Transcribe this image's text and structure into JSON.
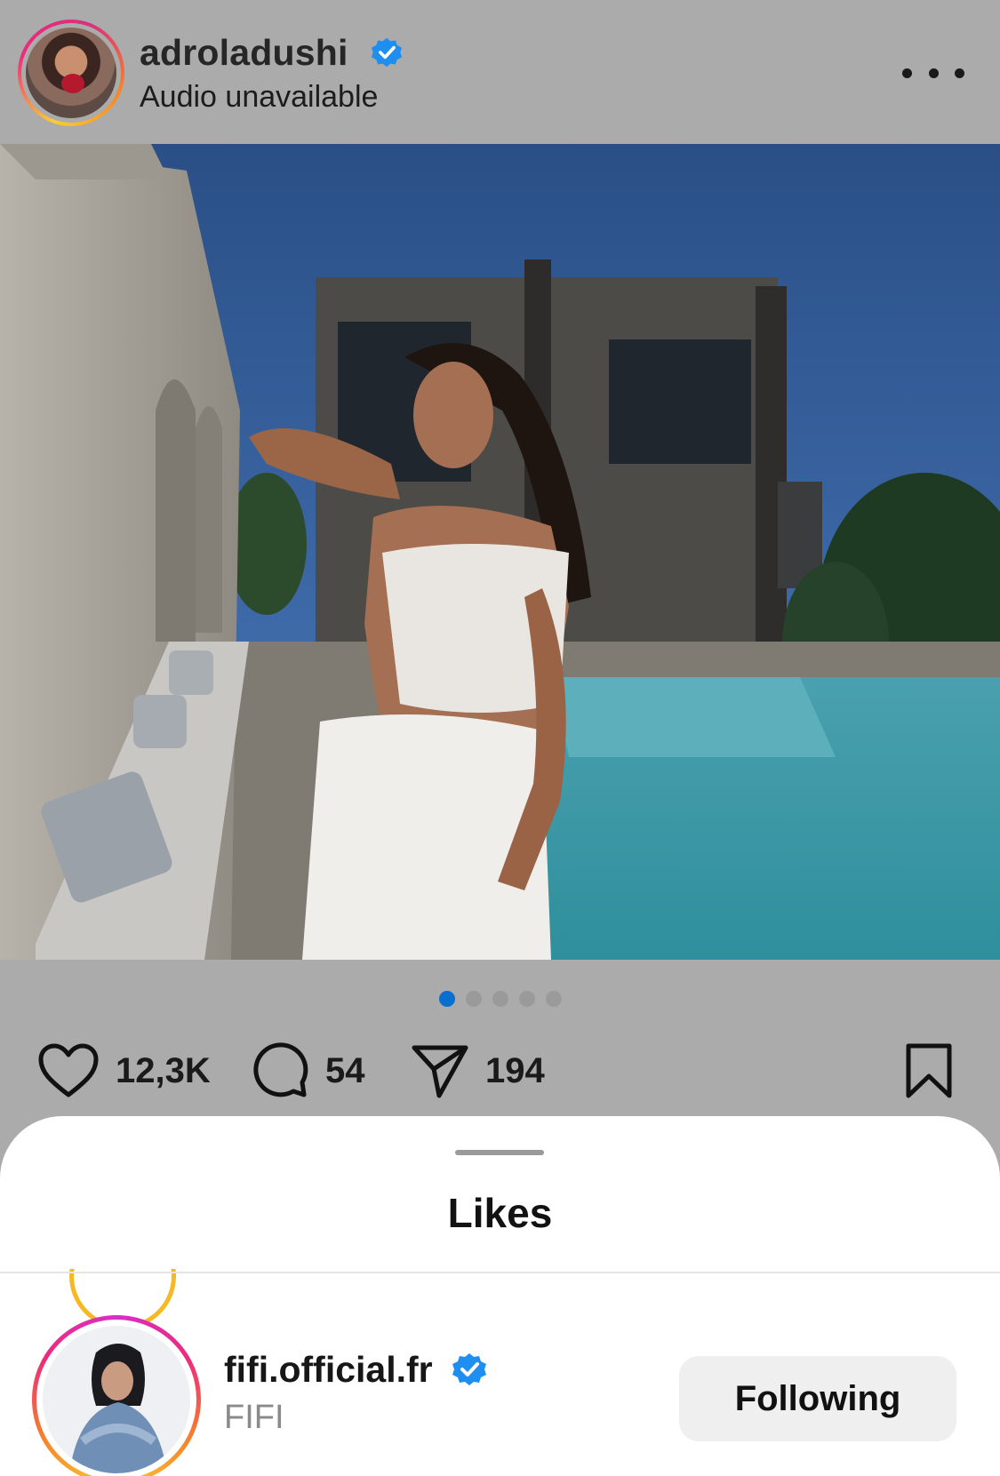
{
  "post": {
    "username": "adroladushi",
    "subtitle": "Audio unavailable",
    "verified": true,
    "carousel": {
      "total": 5,
      "active": 1
    }
  },
  "actions": {
    "likes_count": "12,3K",
    "comments_count": "54",
    "shares_count": "194"
  },
  "likes_sheet": {
    "title": "Likes",
    "users": [
      {
        "username": "fifi.official.fr",
        "display_name": "FIFI",
        "verified": true,
        "button_label": "Following"
      }
    ]
  },
  "colors": {
    "verified_blue": "#1f8ef1",
    "active_dot": "#0a6ecf",
    "overlay_gray": "#ababab"
  },
  "icons": [
    "more-icon",
    "verified-badge-icon",
    "heart-icon",
    "comment-icon",
    "share-icon",
    "bookmark-icon"
  ]
}
